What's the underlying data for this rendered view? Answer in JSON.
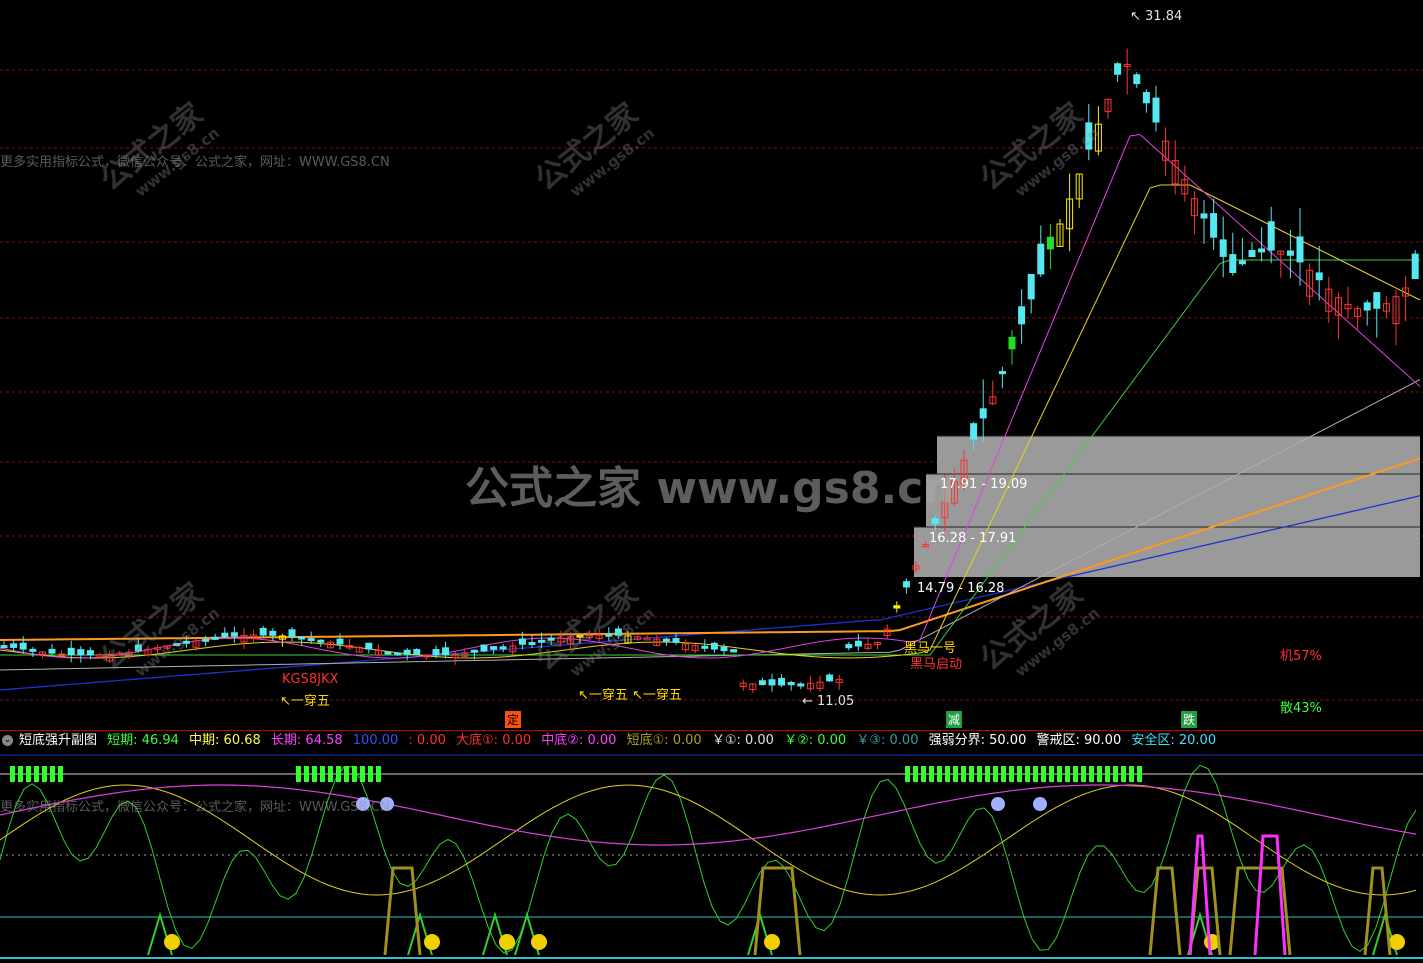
{
  "watermark": {
    "center_text": "公式之家 www.gs8.cn",
    "tile_main": "公式之家",
    "tile_sub": "www.gs8.cn",
    "notice_main": "更多实用指标公式，微信公众号：公式之家，网址：WWW.GS8.CN",
    "notice_sub": "更多实用指标公式，微信公众号：公式之家，网址：WWW.GS8.CN"
  },
  "main_chart": {
    "price_high_label": "31.84",
    "price_low_label": "11.05",
    "zones": [
      {
        "label": "17.91 - 19.09"
      },
      {
        "label": "16.28 - 17.91"
      },
      {
        "label": "14.79 - 16.28"
      }
    ],
    "annotations": {
      "kgs": "KGS8JKX",
      "yichuanwu_1": "一穿五",
      "yichuanwu_2": "一穿五",
      "yichuanwu_3": "一穿五",
      "heima": "黑马一号",
      "heima_start": "黑马启动",
      "ding": "定",
      "jian": "减",
      "die": "跌",
      "ji": "机57%",
      "san": "散43%"
    },
    "colors": {
      "up": "#ff3333",
      "down": "#55e8f0",
      "ma_yellow": "#e6d21a",
      "ma_magenta": "#e040e0",
      "ma_green": "#40d040",
      "ma_white": "#b0b0b0",
      "ma_orange": "#ff9a20",
      "ma_blue": "#2030d0"
    }
  },
  "sub_chart": {
    "title": "短底强升副图",
    "items": [
      {
        "text": "短期: 46.94",
        "color": "#3cff3c"
      },
      {
        "text": "中期: 60.68",
        "color": "#ffff40"
      },
      {
        "text": "长期: 64.58",
        "color": "#ff40ff"
      },
      {
        "text": "100.00",
        "color": "#3050ff"
      },
      {
        "text": ": 0.00",
        "color": "#ff3030"
      },
      {
        "text": "大底①: 0.00",
        "color": "#ff3030"
      },
      {
        "text": "中底②: 0.00",
        "color": "#ff40ff"
      },
      {
        "text": "短底①: 0.00",
        "color": "#b0a020"
      },
      {
        "text": "￥①: 0.00",
        "color": "#e0e0e0"
      },
      {
        "text": "￥②: 0.00",
        "color": "#3cff3c"
      },
      {
        "text": "￥③: 0.00",
        "color": "#30a0a0"
      },
      {
        "text": "强弱分界: 50.00",
        "color": "#ffffff"
      },
      {
        "text": "警戒区: 90.00",
        "color": "#ffffff"
      },
      {
        "text": "安全区: 20.00",
        "color": "#40e0ff"
      }
    ]
  }
}
